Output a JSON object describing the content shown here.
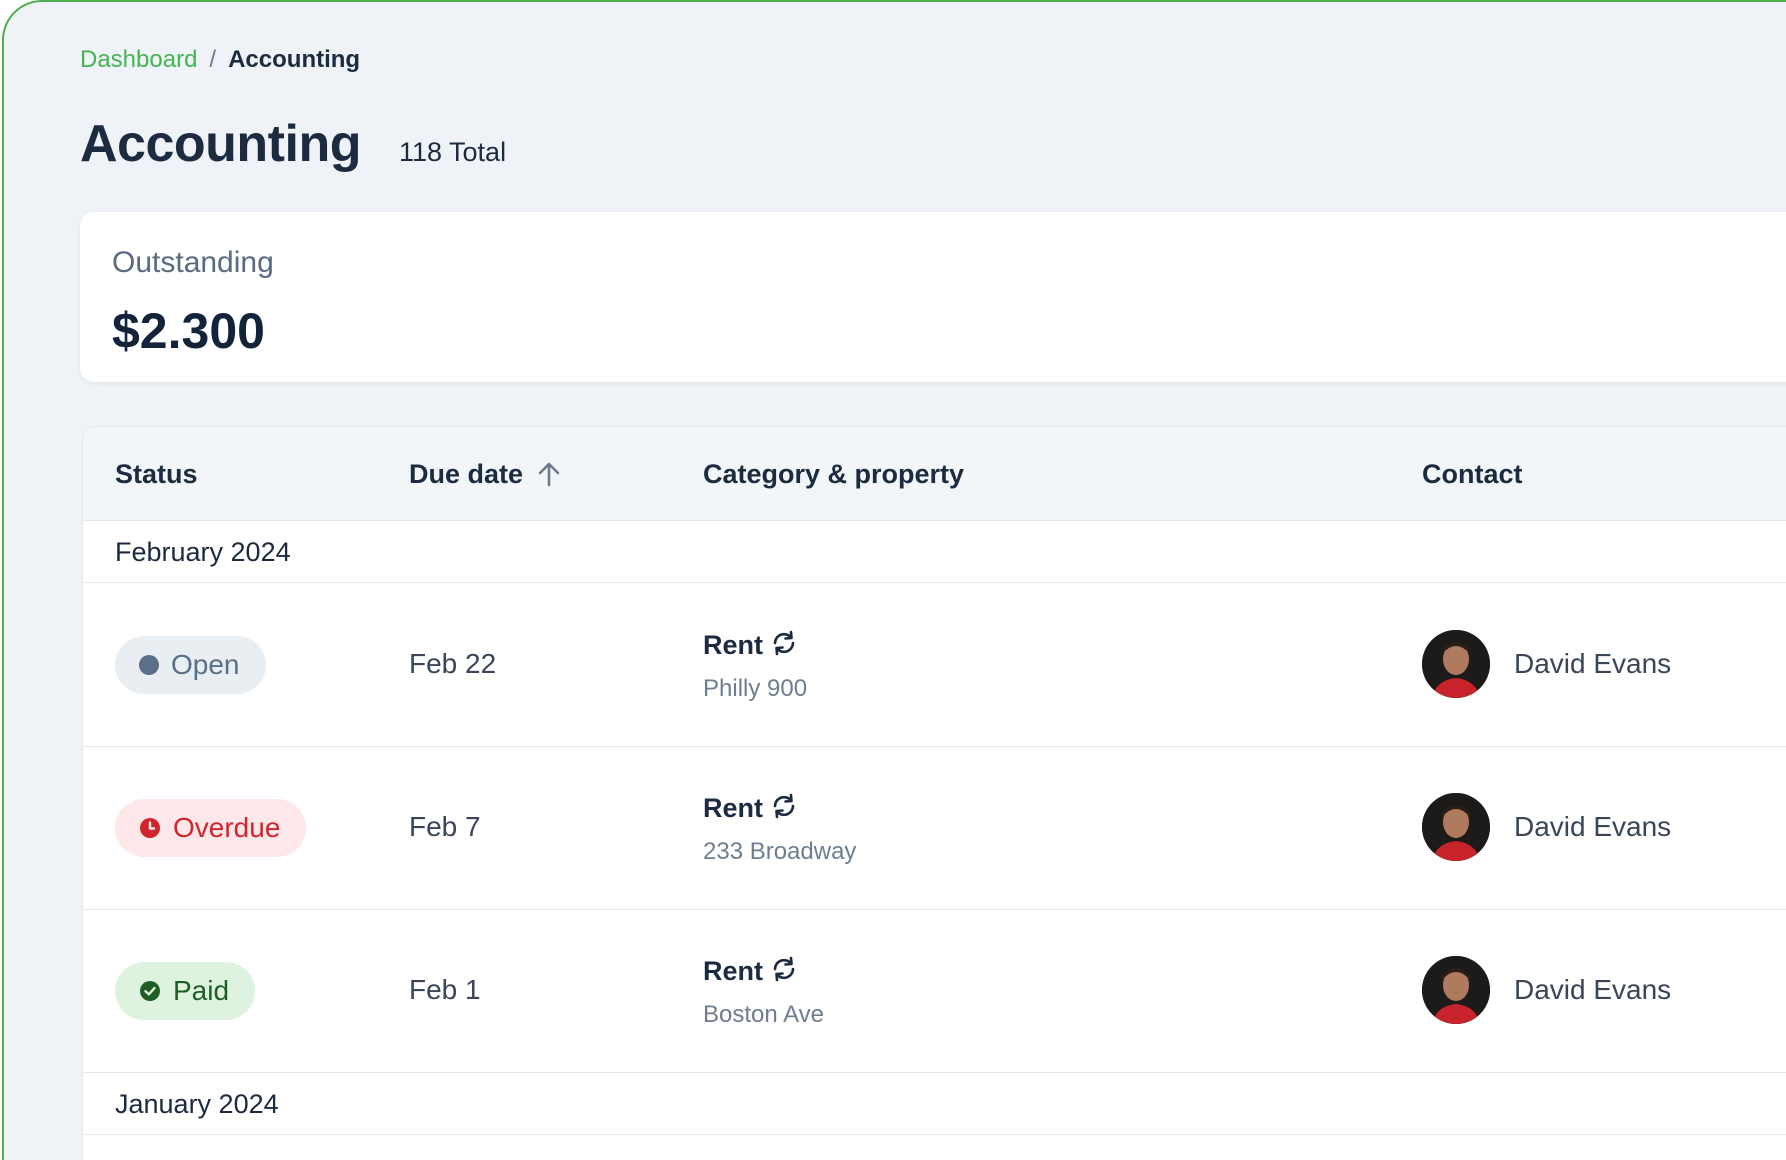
{
  "breadcrumb": {
    "parent": "Dashboard",
    "separator": "/",
    "current": "Accounting"
  },
  "page": {
    "title": "Accounting",
    "total": "118 Total"
  },
  "summary": {
    "label": "Outstanding",
    "value": "$2.300"
  },
  "table": {
    "columns": {
      "status": "Status",
      "due_date": "Due date",
      "category": "Category & property",
      "contact": "Contact"
    },
    "sort": {
      "column": "due_date",
      "direction": "ascending",
      "icon": "arrow-up-icon"
    },
    "groups": [
      {
        "label": "February 2024",
        "rows": [
          {
            "status": "Open",
            "status_icon": "dot-icon",
            "due": "Feb 22",
            "category": "Rent",
            "category_icon": "recurring-icon",
            "property": "Philly 900",
            "contact": "David Evans"
          },
          {
            "status": "Overdue",
            "status_icon": "clock-icon",
            "due": "Feb 7",
            "category": "Rent",
            "category_icon": "recurring-icon",
            "property": "233 Broadway",
            "contact": "David Evans"
          },
          {
            "status": "Paid",
            "status_icon": "check-circle-icon",
            "due": "Feb 1",
            "category": "Rent",
            "category_icon": "recurring-icon",
            "property": "Boston Ave",
            "contact": "David Evans"
          }
        ]
      },
      {
        "label": "January 2024",
        "rows": []
      }
    ]
  },
  "colors": {
    "accent_green": "#45b452",
    "open_text": "#5a6f88",
    "overdue_red": "#d1252e",
    "paid_green": "#1e5e25"
  }
}
